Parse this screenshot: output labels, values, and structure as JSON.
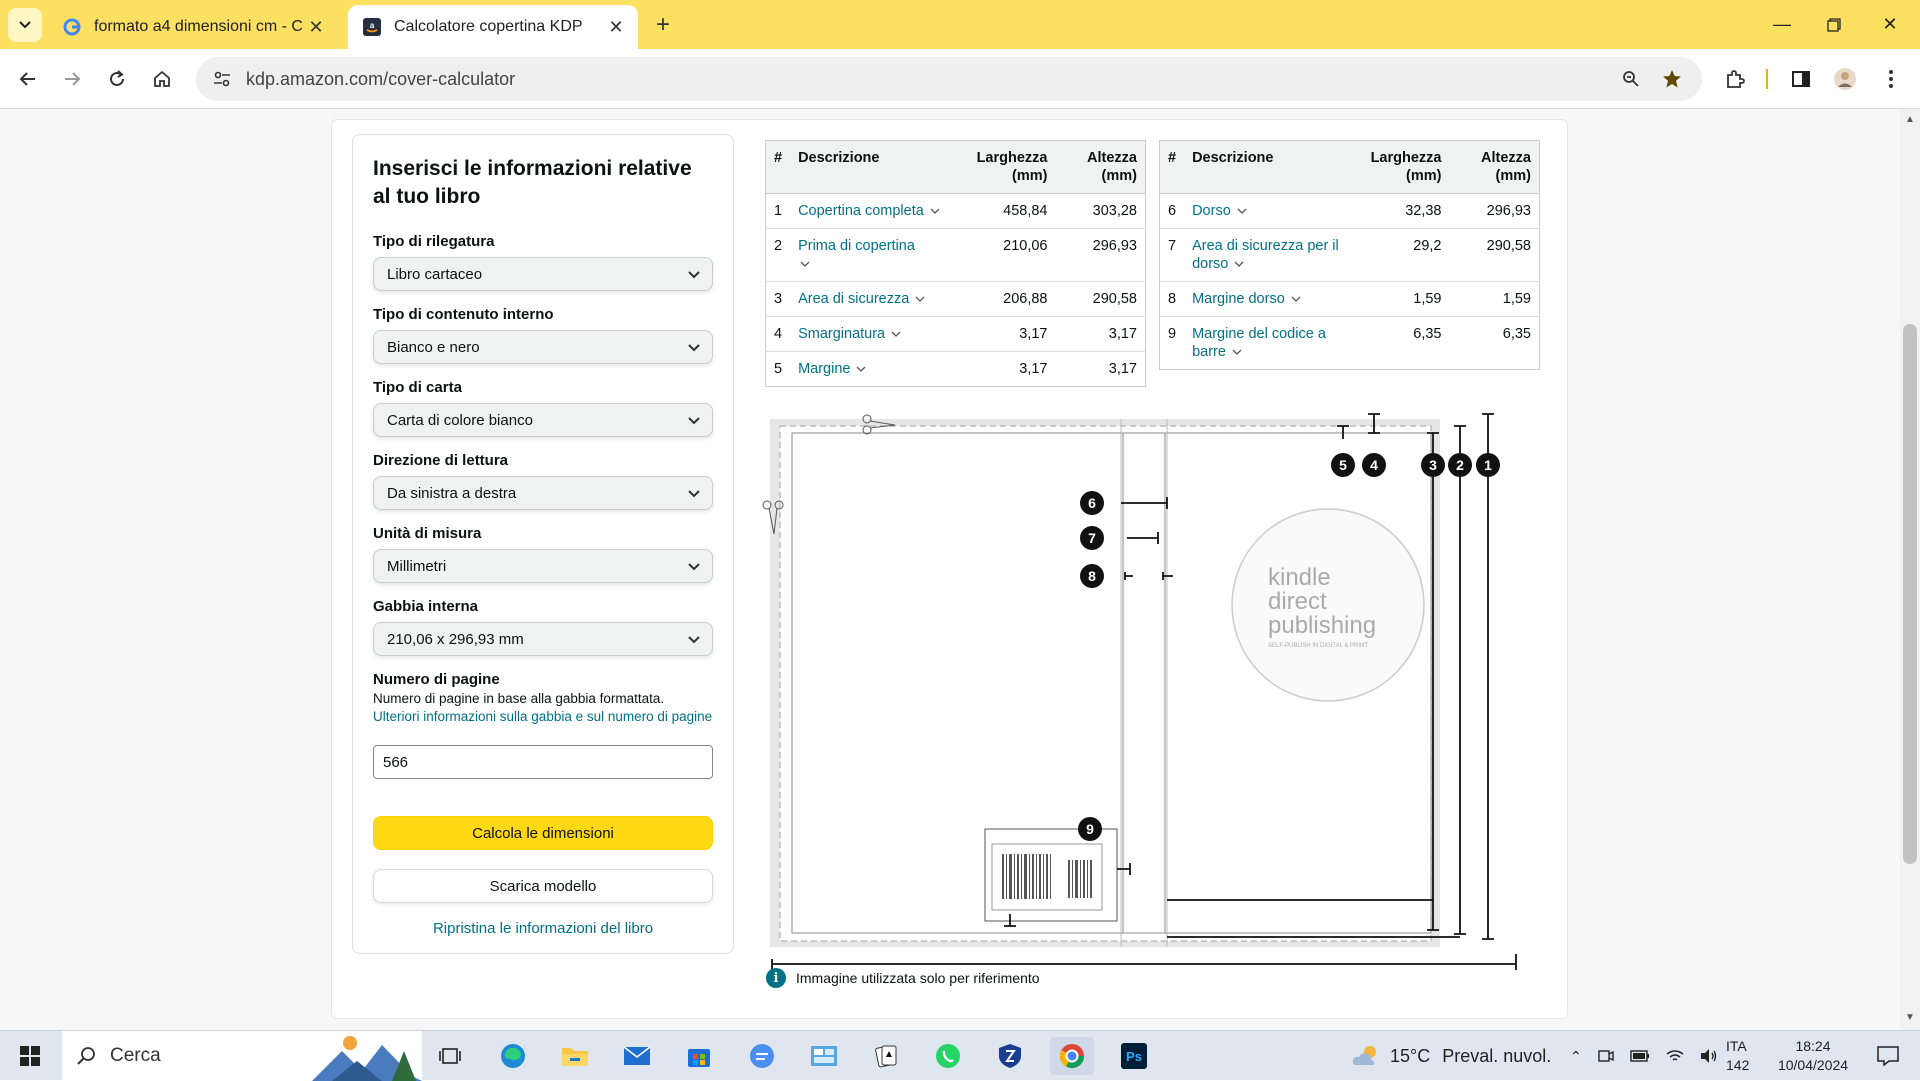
{
  "browser": {
    "tabs": [
      {
        "title": "formato a4 dimensioni cm - Ce",
        "active": false
      },
      {
        "title": "Calcolatore copertina KDP",
        "active": true
      }
    ],
    "url": "kdp.amazon.com/cover-calculator"
  },
  "form": {
    "heading": "Inserisci le informazioni relative al tuo libro",
    "binding_label": "Tipo di rilegatura",
    "binding_value": "Libro cartaceo",
    "interior_label": "Tipo di contenuto interno",
    "interior_value": "Bianco e nero",
    "paper_label": "Tipo di carta",
    "paper_value": "Carta di colore bianco",
    "reading_label": "Direzione di lettura",
    "reading_value": "Da sinistra a destra",
    "unit_label": "Unità di misura",
    "unit_value": "Millimetri",
    "trim_label": "Gabbia interna",
    "trim_value": "210,06 x 296,93 mm",
    "pages_label": "Numero di pagine",
    "pages_note": "Numero di pagine in base alla gabbia formattata.",
    "pages_link": "Ulteriori informazioni sulla gabbia e sul numero di pagine",
    "pages_value": "566",
    "calc_button": "Calcola le dimensioni",
    "download_button": "Scarica modello",
    "reset_link": "Ripristina le informazioni del libro"
  },
  "table_headers": {
    "num": "#",
    "desc": "Descrizione",
    "width": "Larghezza (mm)",
    "height": "Altezza (mm)"
  },
  "table_left": [
    {
      "n": "1",
      "desc": "Copertina completa",
      "w": "458,84",
      "h": "303,28"
    },
    {
      "n": "2",
      "desc": "Prima di copertina",
      "w": "210,06",
      "h": "296,93"
    },
    {
      "n": "3",
      "desc": "Area di sicurezza",
      "w": "206,88",
      "h": "290,58"
    },
    {
      "n": "4",
      "desc": "Smarginatura",
      "w": "3,17",
      "h": "3,17"
    },
    {
      "n": "5",
      "desc": "Margine",
      "w": "3,17",
      "h": "3,17"
    }
  ],
  "table_right": [
    {
      "n": "6",
      "desc": "Dorso",
      "w": "32,38",
      "h": "296,93"
    },
    {
      "n": "7",
      "desc": "Area di sicurezza per il dorso",
      "w": "29,2",
      "h": "290,58"
    },
    {
      "n": "8",
      "desc": "Margine dorso",
      "w": "1,59",
      "h": "1,59"
    },
    {
      "n": "9",
      "desc": "Margine del codice a barre",
      "w": "6,35",
      "h": "6,35"
    }
  ],
  "diagram": {
    "markers": [
      "1",
      "2",
      "3",
      "4",
      "5",
      "6",
      "7",
      "8",
      "9"
    ],
    "logo_lines": [
      "kindle",
      "direct",
      "publishing"
    ],
    "logo_tagline": "SELF-PUBLISH IN DIGITAL & PRINT"
  },
  "reference_note": "Immagine utilizzata solo per riferimento",
  "taskbar": {
    "search_label": "Cerca",
    "weather_temp": "15°C",
    "weather_desc": "Preval. nuvol.",
    "lang": "ITA",
    "lang_sub": "142",
    "time": "18:24",
    "date": "10/04/2024"
  },
  "colors": {
    "chrome_yellow": "#fce061",
    "button_yellow": "#ffd814",
    "link": "#007185"
  }
}
